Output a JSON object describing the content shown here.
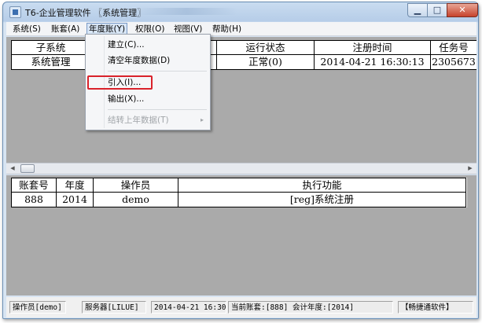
{
  "window": {
    "title": "T6-企业管理软件 〖系统管理〗",
    "buttons": {
      "minimize": "▁",
      "maximize": "□",
      "close": "✕"
    }
  },
  "menubar": {
    "items": [
      {
        "label": "系统(S)"
      },
      {
        "label": "账套(A)"
      },
      {
        "label": "年度账(Y)"
      },
      {
        "label": "权限(O)"
      },
      {
        "label": "视图(V)"
      },
      {
        "label": "帮助(H)"
      }
    ]
  },
  "year_menu": {
    "items": [
      {
        "label": "建立(C)..."
      },
      {
        "label": "清空年度数据(D)"
      },
      {
        "label": "引入(I)..."
      },
      {
        "label": "输出(X)..."
      },
      {
        "label": "结转上年数据(T)",
        "disabled": true,
        "submenu_icon": "▸"
      }
    ]
  },
  "subsystem_table": {
    "headers": [
      "子系统",
      "运行状态",
      "注册时间",
      "任务号"
    ],
    "rows": [
      [
        "系统管理",
        "正常(0)",
        "2014-04-21 16:30:13",
        "2305673"
      ]
    ]
  },
  "log_table": {
    "headers": [
      "账套号",
      "年度",
      "操作员",
      "执行功能"
    ],
    "rows": [
      [
        "888",
        "2014",
        "demo",
        "[reg]系统注册"
      ]
    ]
  },
  "scrollbar": {
    "left": "◀",
    "right": "▶"
  },
  "statusbar": {
    "operator": "操作员[demo]",
    "server": "服务器[LILUE]",
    "datetime": "2014-04-21 16:30",
    "account": "当前账套:[888] 会计年度:[2014]",
    "brand": "【畅捷通软件】"
  },
  "colors": {
    "panel_gray": "#aaaaaa",
    "highlight_red": "#d9222b",
    "menu_active": "#d8e6f6"
  }
}
